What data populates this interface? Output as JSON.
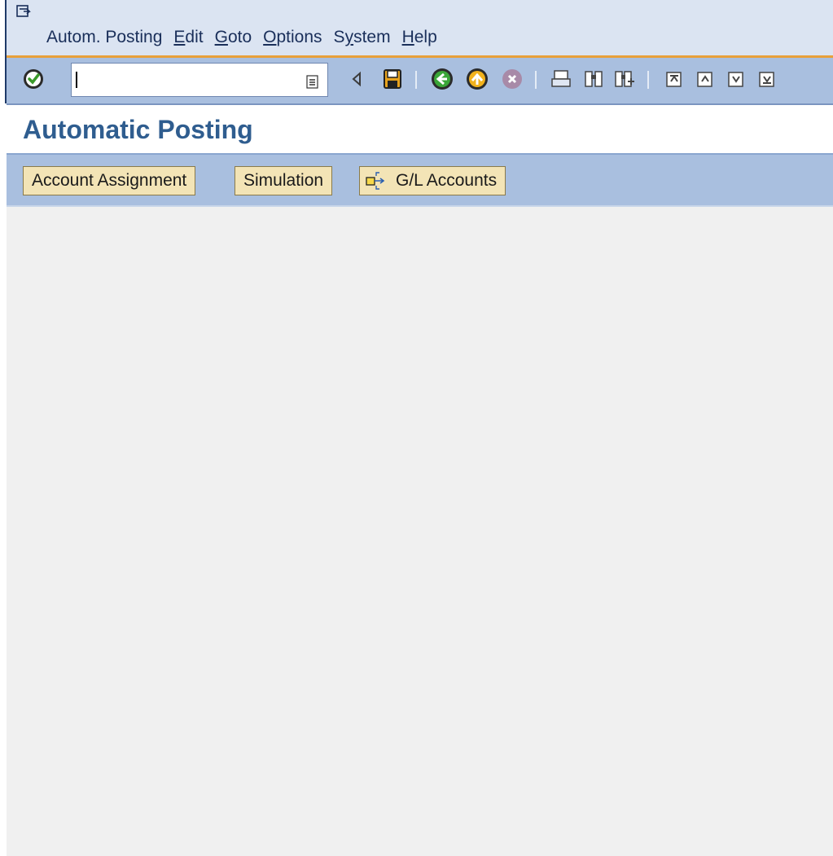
{
  "menubar": {
    "items": [
      {
        "label": "Autom. Posting",
        "underline": ""
      },
      {
        "label": "Edit",
        "underline": "E"
      },
      {
        "label": "Goto",
        "underline": "G"
      },
      {
        "label": "Options",
        "underline": "O"
      },
      {
        "label": "System",
        "underline": "y"
      },
      {
        "label": "Help",
        "underline": "H"
      }
    ]
  },
  "toolbar": {
    "command_value": "",
    "icons": [
      "enter-icon",
      "back-arrow-small-icon",
      "save-icon",
      "back-icon",
      "exit-icon",
      "cancel-icon",
      "print-icon",
      "find-icon",
      "find-next-icon",
      "first-page-icon",
      "previous-page-icon",
      "next-page-icon",
      "last-page-icon"
    ]
  },
  "page": {
    "title": "Automatic Posting"
  },
  "app_toolbar": {
    "account_assignment": "Account Assignment",
    "simulation": "Simulation",
    "gl_accounts": "G/L Accounts"
  },
  "colors": {
    "menubar_bg": "#dbe4f2",
    "toolbar_bg": "#a9bfdf",
    "accent_orange": "#e8a03a",
    "title_color": "#2f5d8f",
    "button_bg": "#f3e4b6",
    "content_bg": "#f0f0f0"
  }
}
